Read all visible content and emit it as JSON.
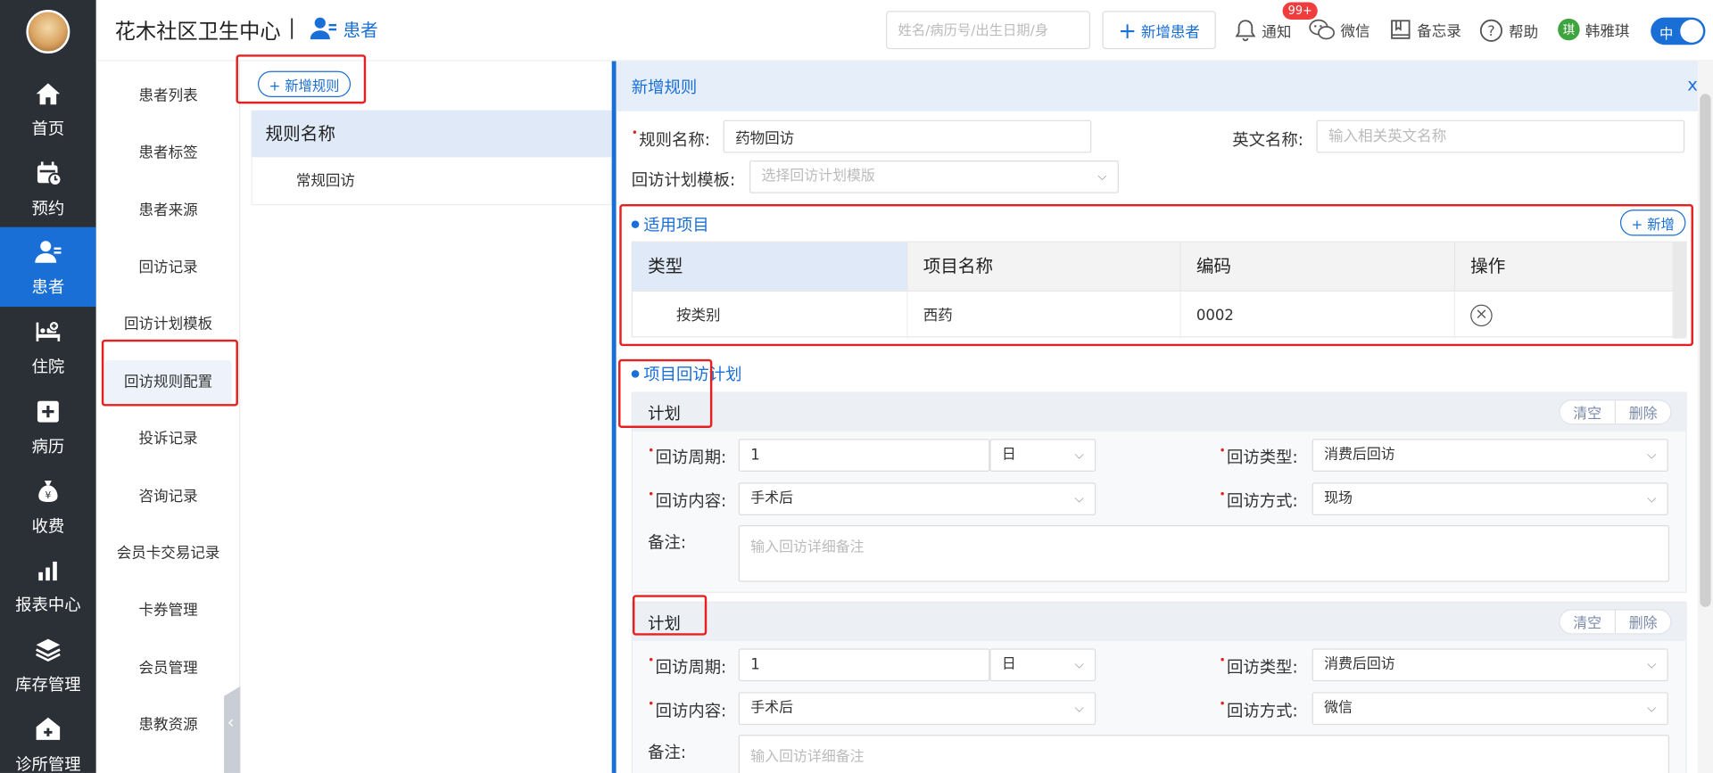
{
  "nav": {
    "items": [
      {
        "label": "首页",
        "icon": "home-icon"
      },
      {
        "label": "预约",
        "icon": "calendar-icon"
      },
      {
        "label": "患者",
        "icon": "user-icon"
      },
      {
        "label": "住院",
        "icon": "bed-icon"
      },
      {
        "label": "病历",
        "icon": "medical-record-icon"
      },
      {
        "label": "收费",
        "icon": "money-bag-icon"
      },
      {
        "label": "报表中心",
        "icon": "bar-chart-icon"
      },
      {
        "label": "库存管理",
        "icon": "layers-icon"
      },
      {
        "label": "诊所管理",
        "icon": "clinic-icon"
      }
    ],
    "active": "患者"
  },
  "header": {
    "clinic_name": "花木社区卫生中心",
    "separator": "|",
    "module": "患者",
    "search_placeholder": "姓名/病历号/出生日期/身",
    "add_patient": "新增患者",
    "notify": "通知",
    "notify_badge": "99+",
    "wechat": "微信",
    "memo": "备忘录",
    "help": "帮助",
    "user_initial": "琪",
    "user_name": "韩雅琪",
    "lang_toggle": "中"
  },
  "subnav": {
    "items": [
      "患者列表",
      "患者标签",
      "患者来源",
      "回访记录",
      "回访计划模板",
      "回访规则配置",
      "投诉记录",
      "咨询记录",
      "会员卡交易记录",
      "卡券管理",
      "会员管理",
      "患教资源"
    ],
    "active": "回访规则配置"
  },
  "middle": {
    "add_rule": "+ 新增规则",
    "list_header": "规则名称",
    "rules": [
      "常规回访"
    ]
  },
  "form": {
    "title": "新增规则",
    "close": "x",
    "rule_name_label": "规则名称:",
    "rule_name_value": "药物回访",
    "english_name_label": "英文名称:",
    "english_name_placeholder": "输入相关英文名称",
    "template_label": "回访计划模板:",
    "template_placeholder": "选择回访计划模版",
    "items_section": "适用项目",
    "add_item": "+ 新增",
    "table_headers": [
      "类型",
      "项目名称",
      "编码",
      "操作"
    ],
    "table_rows": [
      {
        "type": "按类别",
        "name": "西药",
        "code": "0002"
      }
    ],
    "plan_section": "项目回访计划",
    "plans": [
      {
        "title": "计划",
        "clear": "清空",
        "delete": "删除",
        "cycle_label": "回访周期:",
        "cycle_value": "1",
        "cycle_unit": "日",
        "type_label": "回访类型:",
        "type_value": "消费后回访",
        "content_label": "回访内容:",
        "content_value": "手术后",
        "method_label": "回访方式:",
        "method_value": "现场",
        "note_label": "备注:",
        "note_placeholder": "输入回访详细备注"
      },
      {
        "title": "计划",
        "clear": "清空",
        "delete": "删除",
        "cycle_label": "回访周期:",
        "cycle_value": "1",
        "cycle_unit": "日",
        "type_label": "回访类型:",
        "type_value": "消费后回访",
        "content_label": "回访内容:",
        "content_value": "手术后",
        "method_label": "回访方式:",
        "method_value": "微信",
        "note_label": "备注:",
        "note_placeholder": "输入回访详细备注"
      }
    ]
  },
  "colors": {
    "accent": "#1a6fd6",
    "nav_bg": "#2b2f36",
    "highlight": "#e52020"
  }
}
